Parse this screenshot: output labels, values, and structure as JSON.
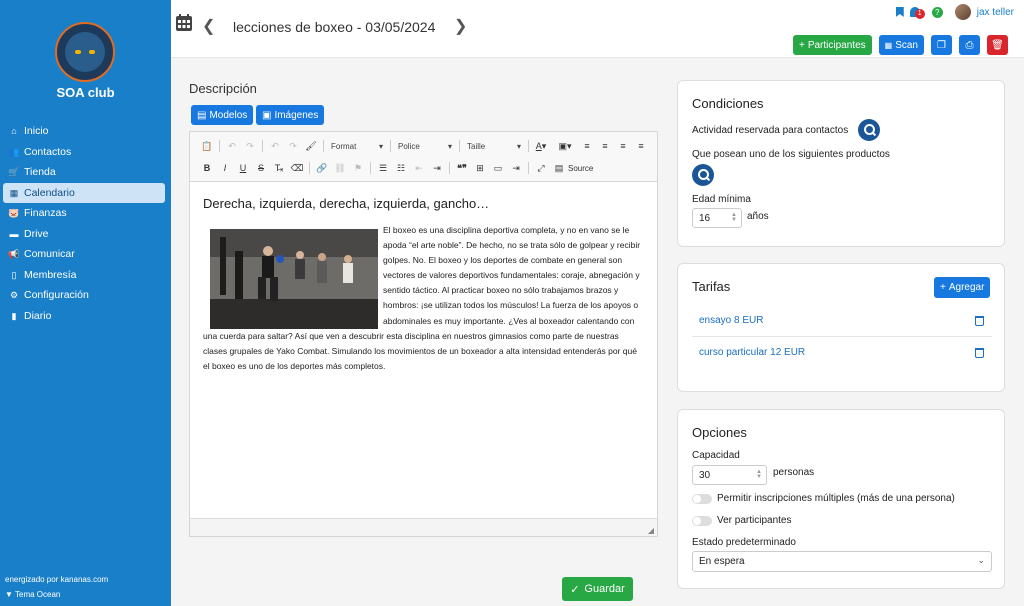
{
  "sidebar": {
    "brand": "SOA club",
    "items": [
      {
        "label": "Inicio",
        "icon": "home-icon",
        "glyph": "⌂"
      },
      {
        "label": "Contactos",
        "icon": "users-icon",
        "glyph": "👥"
      },
      {
        "label": "Tienda",
        "icon": "cart-icon",
        "glyph": "🛒"
      },
      {
        "label": "Calendario",
        "icon": "calendar-icon",
        "glyph": "▦"
      },
      {
        "label": "Finanzas",
        "icon": "piggy-bank-icon",
        "glyph": "🐷"
      },
      {
        "label": "Drive",
        "icon": "folder-icon",
        "glyph": "▬"
      },
      {
        "label": "Comunicar",
        "icon": "megaphone-icon",
        "glyph": "📢"
      },
      {
        "label": "Membresía",
        "icon": "id-card-icon",
        "glyph": "▯"
      },
      {
        "label": "Configuración",
        "icon": "gear-icon",
        "glyph": "⚙"
      },
      {
        "label": "Diario",
        "icon": "book-icon",
        "glyph": "▮"
      }
    ],
    "active_index": 3,
    "footer_powered": "energizado por kananas.com",
    "footer_theme": "Tema Ocean"
  },
  "header": {
    "title": "lecciones de boxeo - 03/05/2024",
    "notifications_count": "1",
    "help": "?",
    "username": "jax teller"
  },
  "actions": {
    "participants": "Participantes",
    "scan": "Scan"
  },
  "editor": {
    "section_title": "Descripción",
    "templates_btn": "Modelos",
    "images_btn": "Imágenes",
    "format": "Format",
    "font": "Police",
    "size": "Taille",
    "source": "Source",
    "heading": "Derecha, izquierda, derecha, izquierda, gancho…",
    "body": "El boxeo es una disciplina deportiva completa, y no en vano se le apoda “el arte noble”. De hecho, no se trata sólo de golpear y recibir golpes. No. El boxeo y los deportes de combate en general son vectores de valores deportivos fundamentales: coraje, abnegación y sentido táctico. Al practicar boxeo no sólo trabajamos brazos y hombros: ¡se utilizan todos los músculos! La fuerza de los apoyos o abdominales es muy importante. ¿Ves al boxeador calentando con una cuerda para saltar? Así que ven a descubrir esta disciplina en nuestros gimnasios como parte de nuestras clases grupales de Yako Combat. Simulando los movimientos de un boxeador a alta intensidad entenderás por qué el boxeo es uno de los deportes más completos."
  },
  "save_label": "Guardar",
  "conditions": {
    "title": "Condiciones",
    "reserved_label": "Actividad reservada para contactos",
    "products_label": "Que posean uno de los siguientes productos",
    "min_age_label": "Edad mínima",
    "min_age_value": "16",
    "years": "años"
  },
  "tarifas": {
    "title": "Tarifas",
    "add": "Agregar",
    "items": [
      {
        "label": "ensayo 8 EUR"
      },
      {
        "label": "curso particular 12 EUR"
      }
    ]
  },
  "options": {
    "title": "Opciones",
    "capacity_label": "Capacidad",
    "capacity_value": "30",
    "persons": "personas",
    "multi_label": "Permitir inscripciones múltiples (más de una persona)",
    "show_label": "Ver participantes",
    "state_label": "Estado predeterminado",
    "state_value": "En espera"
  },
  "colors": {
    "sidebar": "#1a7fc9",
    "primary": "#1779e0",
    "success": "#28a745",
    "danger": "#d9262c"
  }
}
